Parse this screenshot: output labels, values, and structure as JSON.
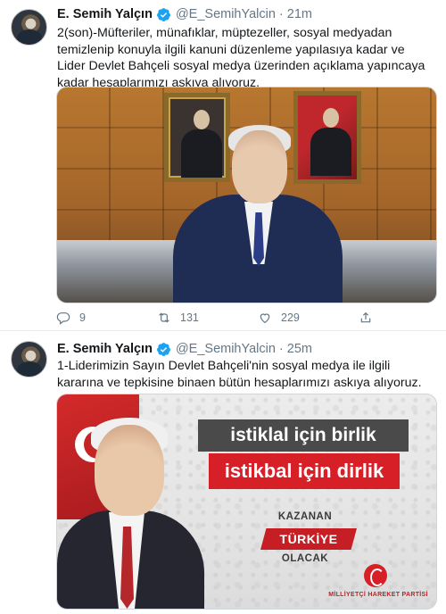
{
  "tweets": [
    {
      "author_name": "E. Semih Yalçın",
      "handle": "@E_SemihYalcin",
      "separator": "·",
      "time": "21m",
      "text": "2(son)-Müfteriler, münafıklar, müptezeller, sosyal medyadan temizlenip konuyla ilgili kanuni düzenleme yapılasıya kadar ve Lider Devlet Bahçeli sosyal medya üzerinden açıklama yapıncaya kadar hesaplarımızı askıya alıyoruz.",
      "replies": "9",
      "retweets": "131",
      "likes": "229"
    },
    {
      "author_name": "E. Semih Yalçın",
      "handle": "@E_SemihYalcin",
      "separator": "·",
      "time": "25m",
      "text": "1-Liderimizin Sayın Devlet Bahçeli'nin sosyal medya ile ilgili kararına ve tepkisine binaen bütün hesaplarımızı askıya alıyoruz.",
      "banner": {
        "slogan_line1": "istiklal için birlik",
        "slogan_line2": "istikbal için dirlik",
        "kazanan": "KAZANAN",
        "turkiye": "TÜRKİYE",
        "olacak": "OLACAK",
        "party_name": "MİLLİYETÇİ HAREKET PARTİSİ"
      }
    }
  ],
  "colors": {
    "verified_blue": "#1da1f2",
    "secondary_text": "#657786",
    "mhp_red": "#d71f28"
  },
  "icons": [
    "verified-badge-icon",
    "reply-icon",
    "retweet-icon",
    "like-icon",
    "share-icon"
  ]
}
